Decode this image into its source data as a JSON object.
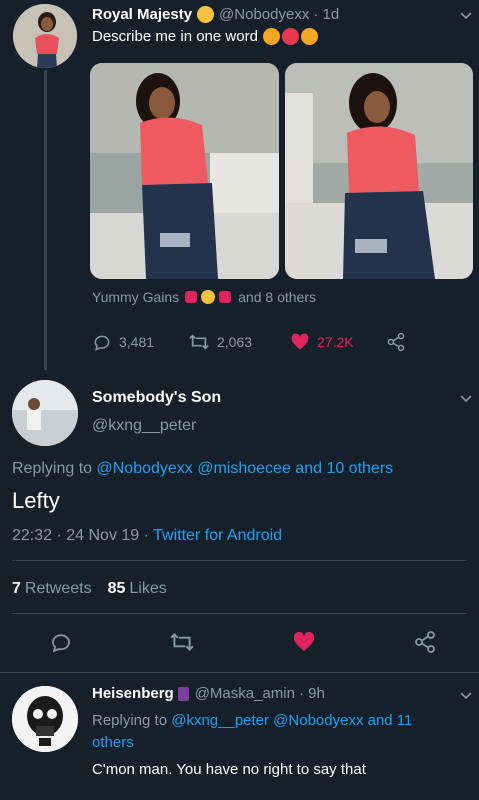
{
  "tweet1": {
    "display_name": "Royal Majesty",
    "handle": "@Nobodyexx",
    "time": "· 1d",
    "text": "Describe me in one word",
    "liked_by": "Yummy Gains",
    "liked_others": "and 8 others",
    "replies": "3,481",
    "retweets": "2,063",
    "likes": "27.2K"
  },
  "main": {
    "display_name": "Somebody's Son",
    "handle": "@kxng__peter",
    "replying_prefix": "Replying to",
    "replying_mentions": "@Nobodyexx @mishoecee and 10 others",
    "text": "Lefty",
    "timestamp": "22:32 · 24 Nov 19 ·",
    "client": "Twitter for Android",
    "retweets_count": "7",
    "retweets_label": "Retweets",
    "likes_count": "85",
    "likes_label": "Likes"
  },
  "reply": {
    "display_name": "Heisenberg",
    "handle": "@Maska_amin",
    "time": "· 9h",
    "replying_prefix": "Replying to",
    "replying_mentions": "@kxng__peter @Nobodyexx and 11 others",
    "text": "C'mon man. You have no right to say that"
  },
  "colors": {
    "background": "#15202b",
    "link": "#1da1f2",
    "like": "#e0245e",
    "muted": "#8899a6"
  }
}
